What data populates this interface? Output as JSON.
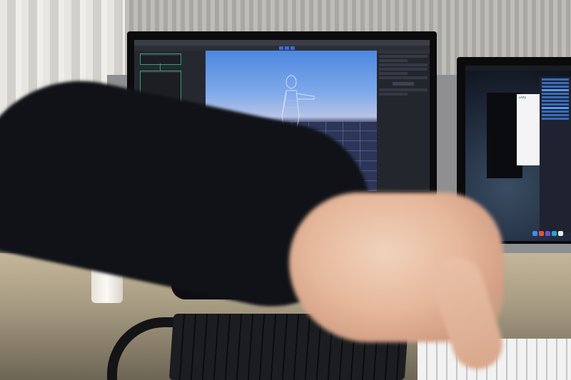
{
  "scene": {
    "main_monitor": {
      "window_title": "",
      "graph_nodes": [
        {
          "title": "",
          "sub": ""
        },
        {
          "title": "",
          "sub": ""
        },
        {
          "title": "",
          "sub": ""
        },
        {
          "title": "",
          "sub": ""
        }
      ],
      "inspector": {
        "title": "",
        "button_label": ""
      }
    },
    "side_monitor": {
      "menubar": "",
      "finder_title": "unity",
      "finder_items": [
        "",
        "",
        "",
        ""
      ]
    },
    "colors": {
      "play_button": "#3d6bd6",
      "node_green": "#2ea36b",
      "node_orange": "#c9802a",
      "sky": "#4d87e0"
    },
    "icons": [
      "play-icon",
      "pause-icon",
      "step-icon"
    ]
  }
}
